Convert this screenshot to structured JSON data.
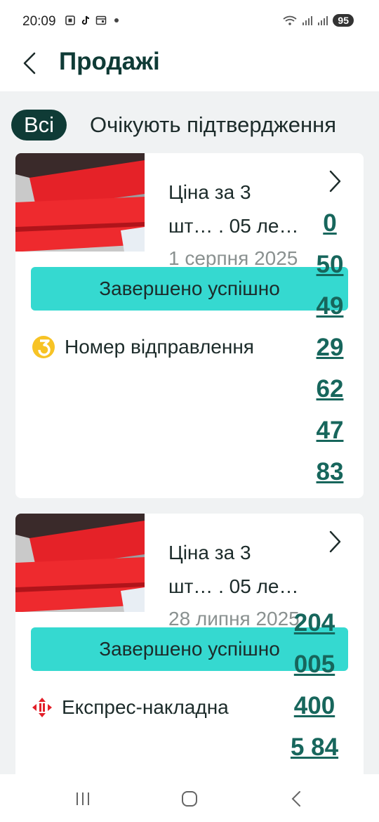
{
  "status_bar": {
    "time": "20:09",
    "battery": "95",
    "icons": [
      "screenshot-icon",
      "tiktok-icon",
      "calendar-icon",
      "dot-icon",
      "wifi-icon",
      "signal-icon",
      "signal-icon-2"
    ]
  },
  "header": {
    "title": "Продажі",
    "back_icon": "chevron-left-icon"
  },
  "filters": {
    "active": "Всі",
    "inactive": "Очікують підтвердження"
  },
  "orders": [
    {
      "title_line1": "Ціна за 3",
      "title_line2": "шт… . 05 лe…",
      "date": "1 серпня 2025",
      "status": "Завершено успішно",
      "delivery_label": "Номер відправлення",
      "delivery_icon": "ukrposhta-icon",
      "tracking_lines": [
        "0",
        "50",
        "49",
        "29",
        "62",
        "47",
        "83"
      ]
    },
    {
      "title_line1": "Ціна за 3",
      "title_line2": "шт… . 05 ле…",
      "date": "28 липня 2025",
      "status": "Завершено успішно",
      "delivery_label": "Експрес-накладна",
      "delivery_icon": "nova-poshta-icon",
      "tracking_lines": [
        "204",
        "005",
        "400",
        "5 84"
      ]
    }
  ],
  "colors": {
    "accent_dark": "#0f3b36",
    "status_pill": "#35d9d0",
    "tracking_link": "#17665c",
    "background": "#f0f2f3"
  },
  "nav_bar": {
    "icons": [
      "recents-icon",
      "home-icon",
      "back-icon"
    ]
  }
}
